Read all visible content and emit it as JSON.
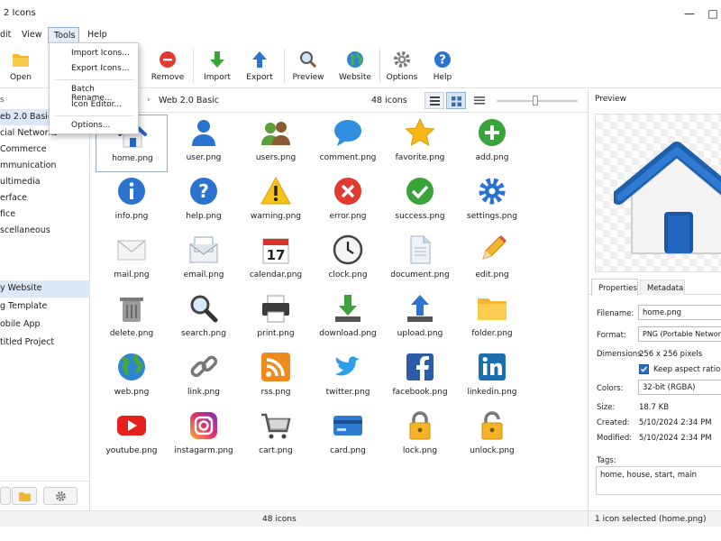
{
  "window": {
    "title": "2 Icons"
  },
  "menu": {
    "items": [
      "dit",
      "View",
      "Tools",
      "Help"
    ]
  },
  "dropdown": {
    "items": [
      "Import Icons...",
      "Export Icons...",
      "Batch Rename...",
      "Icon Editor...",
      "Options..."
    ]
  },
  "toolbar": {
    "open": "Open",
    "remove": "Remove",
    "import": "Import",
    "export": "Export",
    "preview": "Preview",
    "website": "Website",
    "options": "Options",
    "help": "Help"
  },
  "sidebar": {
    "collections": [
      "eb 2.0 Basic",
      "cial Networks",
      "Commerce",
      "mmunication",
      "ultimedia",
      "erface",
      "fice",
      "scellaneous"
    ],
    "projects": [
      "y Website",
      "g Template",
      "obile App",
      "titled Project"
    ]
  },
  "pathbar": {
    "path": "Web 2.0 Basic",
    "count": "48 icons"
  },
  "icons": [
    {
      "name": "home.png",
      "icon": "home-icon"
    },
    {
      "name": "user.png",
      "icon": "user-icon"
    },
    {
      "name": "users.png",
      "icon": "users-icon"
    },
    {
      "name": "comment.png",
      "icon": "comment-icon"
    },
    {
      "name": "favorite.png",
      "icon": "star-icon"
    },
    {
      "name": "add.png",
      "icon": "add-icon"
    },
    {
      "name": "info.png",
      "icon": "info-icon"
    },
    {
      "name": "help.png",
      "icon": "help-icon"
    },
    {
      "name": "warning.png",
      "icon": "warning-icon"
    },
    {
      "name": "error.png",
      "icon": "error-icon"
    },
    {
      "name": "success.png",
      "icon": "success-icon"
    },
    {
      "name": "settings.png",
      "icon": "gear-icon"
    },
    {
      "name": "mail.png",
      "icon": "mail-icon"
    },
    {
      "name": "email.png",
      "icon": "email-icon"
    },
    {
      "name": "calendar.png",
      "icon": "calendar-icon"
    },
    {
      "name": "clock.png",
      "icon": "clock-icon"
    },
    {
      "name": "document.png",
      "icon": "document-icon"
    },
    {
      "name": "edit.png",
      "icon": "pencil-icon"
    },
    {
      "name": "delete.png",
      "icon": "trash-icon"
    },
    {
      "name": "search.png",
      "icon": "search-icon"
    },
    {
      "name": "print.png",
      "icon": "printer-icon"
    },
    {
      "name": "download.png",
      "icon": "download-icon"
    },
    {
      "name": "upload.png",
      "icon": "upload-icon"
    },
    {
      "name": "folder.png",
      "icon": "folder-icon"
    },
    {
      "name": "web.png",
      "icon": "globe-icon"
    },
    {
      "name": "link.png",
      "icon": "link-icon"
    },
    {
      "name": "rss.png",
      "icon": "rss-icon"
    },
    {
      "name": "twitter.png",
      "icon": "twitter-icon"
    },
    {
      "name": "facebook.png",
      "icon": "facebook-icon"
    },
    {
      "name": "linkedin.png",
      "icon": "linkedin-icon"
    },
    {
      "name": "youtube.png",
      "icon": "youtube-icon"
    },
    {
      "name": "instagarm.png",
      "icon": "instagram-icon"
    },
    {
      "name": "cart.png",
      "icon": "cart-icon"
    },
    {
      "name": "card.png",
      "icon": "card-icon"
    },
    {
      "name": "lock.png",
      "icon": "lock-icon"
    },
    {
      "name": "unlock.png",
      "icon": "unlock-icon"
    }
  ],
  "preview": {
    "title": "Preview"
  },
  "properties": {
    "tab_properties": "Properties",
    "tab_metadata": "Metadata",
    "filename_label": "Filename:",
    "filename": "home.png",
    "format_label": "Format:",
    "format": "PNG (Portable Network Graphics)",
    "dimensions_label": "Dimensions:",
    "dimensions": "256 x 256 pixels",
    "keep_aspect": "Keep aspect ratio",
    "colors_label": "Colors:",
    "colors": "32-bit (RGBA)",
    "size_label": "Size:",
    "size": "18.7 KB",
    "created_label": "Created:",
    "created": "5/10/2024  2:34 PM",
    "modified_label": "Modified:",
    "modified": "5/10/2024  2:34 PM",
    "tags_label": "Tags:",
    "tags": "home, house, start, main"
  },
  "status": {
    "center": "48 icons",
    "right": "1 icon selected (home.png)"
  },
  "colors": {
    "accent": "#2a6fc0",
    "selection": "#dbe8f7"
  }
}
